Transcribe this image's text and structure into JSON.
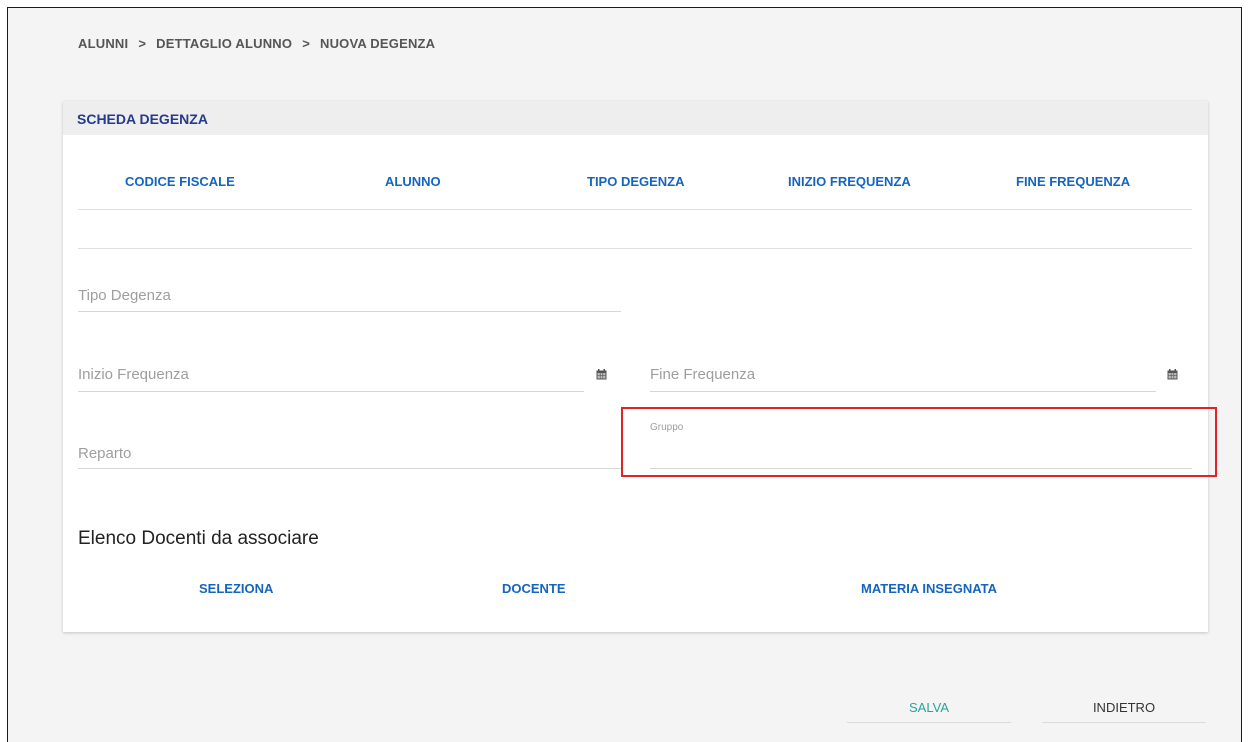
{
  "breadcrumb": {
    "items": [
      "ALUNNI",
      "DETTAGLIO ALUNNO",
      "NUOVA DEGENZA"
    ],
    "separator": ">"
  },
  "card": {
    "title": "SCHEDA DEGENZA",
    "table_headers": [
      "CODICE FISCALE",
      "ALUNNO",
      "TIPO DEGENZA",
      "INIZIO FREQUENZA",
      "FINE FREQUENZA"
    ]
  },
  "form": {
    "tipo_degenza_label": "Tipo Degenza",
    "inizio_frequenza_label": "Inizio Frequenza",
    "fine_frequenza_label": "Fine Frequenza",
    "reparto_label": "Reparto",
    "gruppo_label": "Gruppo",
    "calendar_icon": "calendar-icon"
  },
  "docenti": {
    "title": "Elenco Docenti da associare",
    "headers": [
      "SELEZIONA",
      "DOCENTE",
      "MATERIA INSEGNATA"
    ]
  },
  "actions": {
    "save_label": "SALVA",
    "back_label": "INDIETRO"
  },
  "colors": {
    "accent_blue": "#1565c0",
    "title_blue": "#263a8c",
    "save_green": "#26a69a",
    "highlight_red": "#e02424"
  }
}
